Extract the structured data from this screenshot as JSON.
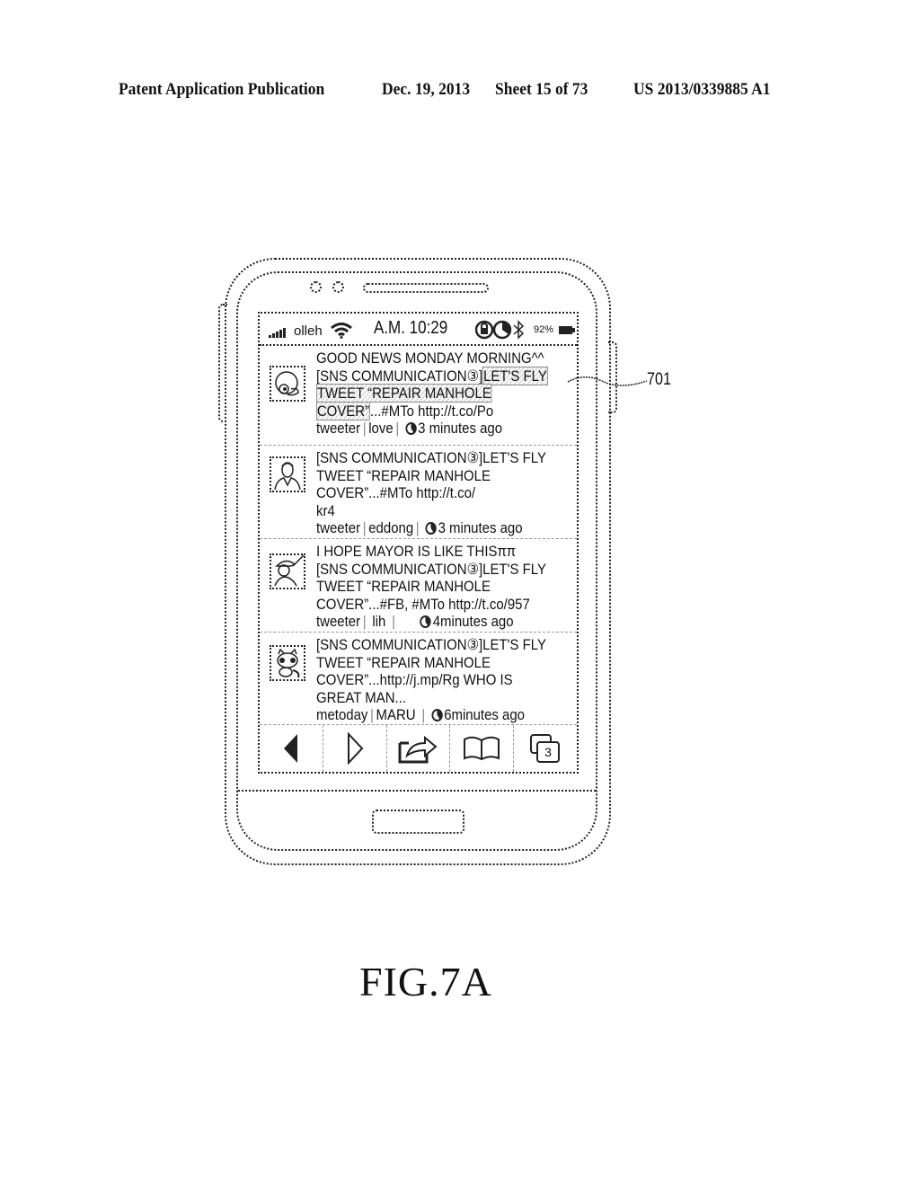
{
  "header": {
    "publication": "Patent Application Publication",
    "date": "Dec. 19, 2013",
    "sheet": "Sheet 15 of 73",
    "number": "US 2013/0339885 A1"
  },
  "status_bar": {
    "signal_icon": "signal-bars-icon",
    "carrier": "olleh",
    "wifi_icon": "wifi-icon",
    "time": "A.M. 10:29",
    "icons": [
      "lock-rotate-icon",
      "clock-icon",
      "bluetooth-icon",
      "battery-icon"
    ],
    "battery": "92%"
  },
  "feed": [
    {
      "avatar": "duck-avatar-icon",
      "lines": [
        "GOOD NEWS MONDAY MORNING^^"
      ],
      "line2_plain": "[SNS COMMUNICATION③]",
      "line2_highlight": "LET'S FLY",
      "line3_highlight": "TWEET “REPAIR MANHOLE",
      "line4_highlight": "COVER”",
      "line4_plain": "...#MTo http://t.co/Po",
      "source": "tweeter",
      "user": "love",
      "time": "3 minutes ago"
    },
    {
      "avatar": "man-in-suit-avatar-icon",
      "lines": [
        "[SNS COMMUNICATION③]LET'S FLY",
        "TWEET “REPAIR MANHOLE",
        "COVER”...#MTo http://t.co/",
        "kr4"
      ],
      "source": "tweeter",
      "user": "eddong",
      "time": "3 minutes ago"
    },
    {
      "avatar": "man-with-hat-avatar-icon",
      "lines": [
        "I HOPE MAYOR IS LIKE THISππ",
        "[SNS COMMUNICATION③]LET'S FLY",
        "TWEET “REPAIR MANHOLE",
        "COVER”...#FB, #MTo http://t.co/957"
      ],
      "source": "tweeter",
      "user": "lih",
      "time": "4minutes ago"
    },
    {
      "avatar": "raccoon-avatar-icon",
      "lines": [
        "[SNS COMMUNICATION③]LET'S FLY",
        "TWEET “REPAIR MANHOLE",
        "COVER”...http://j.mp/Rg WHO IS",
        "GREAT MAN..."
      ],
      "source": "metoday",
      "user": "MARU",
      "time": "6minutes ago"
    }
  ],
  "nav": [
    {
      "icon": "back-arrow-icon"
    },
    {
      "icon": "forward-arrow-icon"
    },
    {
      "icon": "share-icon"
    },
    {
      "icon": "book-icon"
    },
    {
      "icon": "windows-icon",
      "badge": "3"
    }
  ],
  "callout": "701",
  "figure_label": "FIG.7A"
}
